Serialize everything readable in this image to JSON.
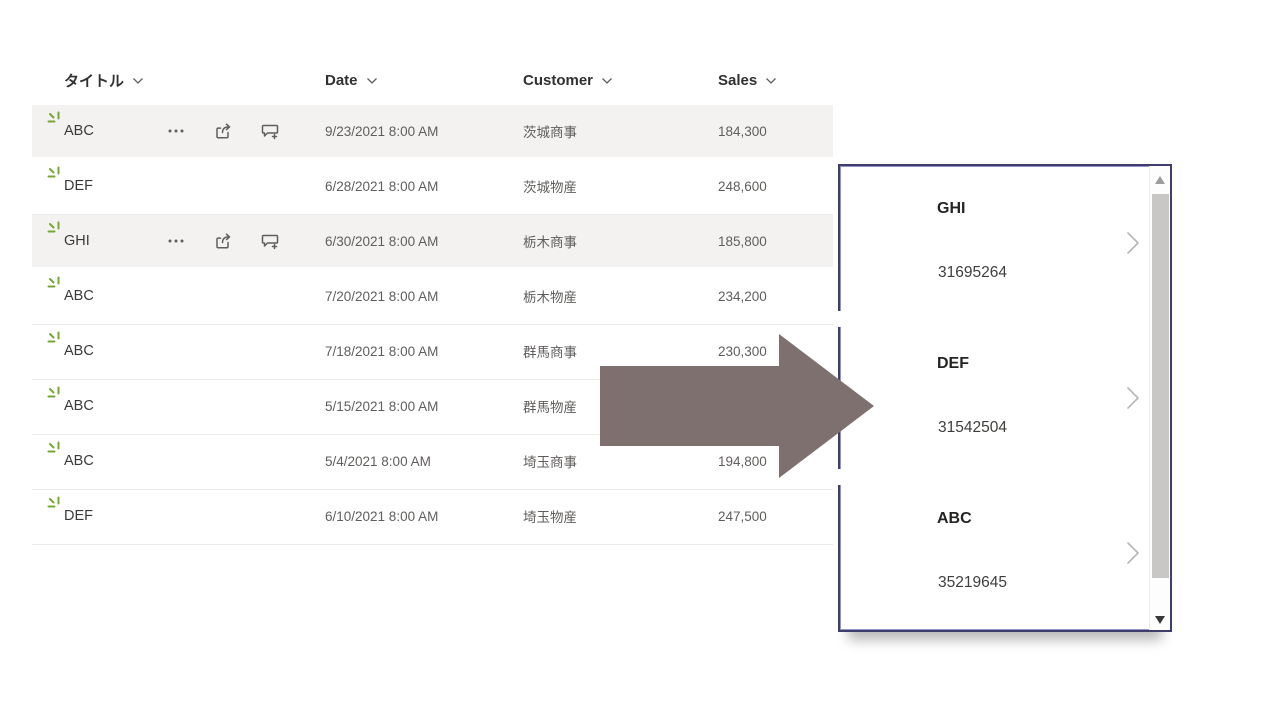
{
  "table": {
    "columns": [
      {
        "label": "タイトル"
      },
      {
        "label": "Date"
      },
      {
        "label": "Customer"
      },
      {
        "label": "Sales"
      }
    ],
    "rows": [
      {
        "title": "ABC",
        "date": "9/23/2021 8:00 AM",
        "customer": "茨城商事",
        "sales": "184,300",
        "hover_actions_visible": true,
        "is_new": true
      },
      {
        "title": "DEF",
        "date": "6/28/2021 8:00 AM",
        "customer": "茨城物産",
        "sales": "248,600",
        "hover_actions_visible": false,
        "is_new": true
      },
      {
        "title": "GHI",
        "date": "6/30/2021 8:00 AM",
        "customer": "栃木商事",
        "sales": "185,800",
        "hover_actions_visible": true,
        "is_new": true
      },
      {
        "title": "ABC",
        "date": "7/20/2021 8:00 AM",
        "customer": "栃木物産",
        "sales": "234,200",
        "hover_actions_visible": false,
        "is_new": true
      },
      {
        "title": "ABC",
        "date": "7/18/2021 8:00 AM",
        "customer": "群馬商事",
        "sales": "230,300",
        "hover_actions_visible": false,
        "is_new": true
      },
      {
        "title": "ABC",
        "date": "5/15/2021 8:00 AM",
        "customer": "群馬物産",
        "sales": "",
        "hover_actions_visible": false,
        "is_new": true
      },
      {
        "title": "ABC",
        "date": "5/4/2021 8:00 AM",
        "customer": "埼玉商事",
        "sales": "194,800",
        "hover_actions_visible": false,
        "is_new": true
      },
      {
        "title": "DEF",
        "date": "6/10/2021 8:00 AM",
        "customer": "埼玉物産",
        "sales": "247,500",
        "hover_actions_visible": false,
        "is_new": true
      }
    ],
    "row_actions": {
      "more": "···"
    }
  },
  "gallery": {
    "items": [
      {
        "title": "GHI",
        "value": "31695264"
      },
      {
        "title": "DEF",
        "value": "31542504"
      },
      {
        "title": "ABC",
        "value": "35219645"
      }
    ]
  },
  "colors": {
    "hover_row_bg": "#f3f2f1",
    "separator": "#edebe9",
    "header_text": "#323130",
    "secondary_text": "#605e5c",
    "new_item_green": "#76a832",
    "arrow_fill": "#7e706e",
    "panel_border": "#3f3e6b",
    "panel_border_inner": "#9193c9",
    "scroll_thumb": "#c9c7c5"
  }
}
